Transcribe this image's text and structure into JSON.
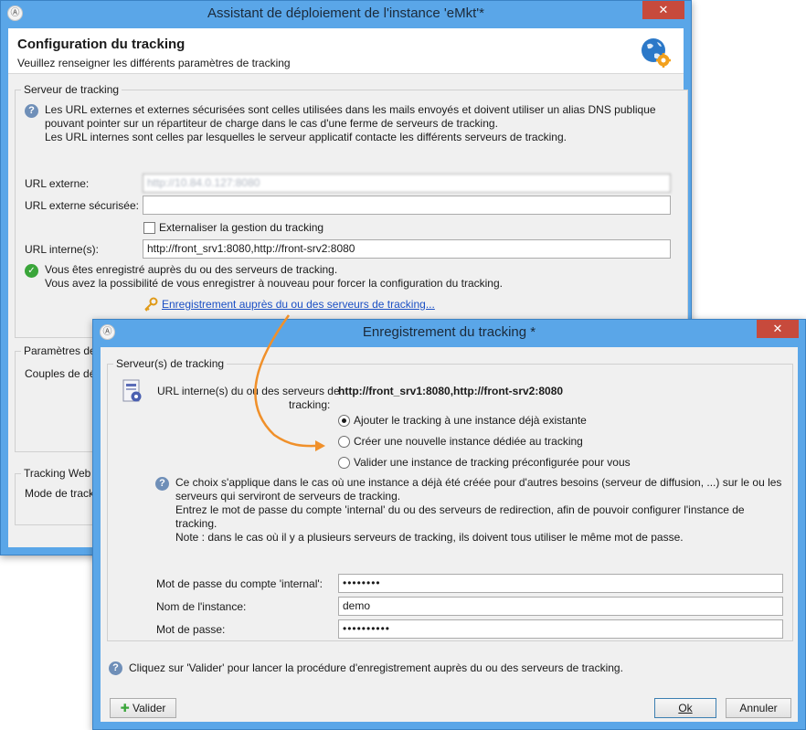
{
  "back_window": {
    "title": "Assistant de déploiement de l'instance 'eMkt'*",
    "heading": "Configuration du tracking",
    "subheading": "Veuillez renseigner les différents paramètres de tracking",
    "server_group": {
      "legend": "Serveur de tracking",
      "help_line1": "Les URL externes et externes sécurisées sont celles utilisées dans les mails envoyés et doivent utiliser un alias DNS publique",
      "help_line2": "pouvant pointer sur un répartiteur de charge dans le cas d'une ferme de serveurs de tracking.",
      "help_line3": "Les URL internes sont celles par lesquelles le serveur applicatif contacte les différents serveurs de tracking.",
      "external_url_label": "URL externe:",
      "external_url_value": "http://10.84.0.127:8080",
      "secure_url_label": "URL externe sécurisée:",
      "secure_url_value": "",
      "externalize_label": "Externaliser la gestion du tracking",
      "internal_url_label": "URL interne(s):",
      "internal_url_value": "http://front_srv1:8080,http://front-srv2:8080",
      "status_line1": "Vous êtes enregistré auprès du ou des serveurs de tracking.",
      "status_line2": "Vous avez la possibilité de vous enregistrer à nouveau pour forcer la configuration du tracking.",
      "register_link": "Enregistrement auprès du ou des serveurs de tracking..."
    },
    "params_group": {
      "legend": "Paramètres de",
      "couples_label": "Couples de dé"
    },
    "web_group": {
      "legend": "Tracking Web",
      "mode_label": "Mode de track"
    }
  },
  "front_window": {
    "title": "Enregistrement du tracking *",
    "group_legend": "Serveur(s) de tracking",
    "internal_url_label_line1": "URL interne(s) du ou des serveurs de",
    "internal_url_label_line2": "tracking:",
    "internal_url_value": "http://front_srv1:8080,http://front-srv2:8080",
    "options": [
      {
        "label": "Ajouter le tracking à une instance déjà existante",
        "checked": true
      },
      {
        "label": "Créer une nouvelle instance dédiée au tracking",
        "checked": false
      },
      {
        "label": "Valider une instance de tracking préconfigurée pour vous",
        "checked": false
      }
    ],
    "info_line1": "Ce choix s'applique dans le cas où une instance a déjà été créée pour d'autres besoins (serveur de diffusion, ...) sur le ou les",
    "info_line2": "serveurs qui serviront de serveurs de tracking.",
    "info_line3": "Entrez le mot de passe du compte 'internal' du ou des serveurs de redirection, afin de pouvoir configurer l'instance de",
    "info_line4": "tracking.",
    "info_line5": "Note : dans le cas où il y a plusieurs serveurs de tracking, ils doivent tous utiliser le même mot de passe.",
    "internal_password_label": "Mot de passe du compte 'internal':",
    "internal_password_value": "••••••••",
    "instance_name_label": "Nom de l'instance:",
    "instance_name_value": "demo",
    "password_label": "Mot de passe:",
    "password_value": "••••••••••",
    "footer_help": "Cliquez sur 'Valider' pour lancer la procédure d'enregistrement auprès du ou des serveurs de tracking.",
    "validate_button": "Valider",
    "ok_button": "Ok",
    "cancel_button": "Annuler"
  },
  "colors": {
    "title_bar": "#5aa6e8",
    "close_button": "#c74a3c",
    "link": "#1a4fc4",
    "arrow": "#f0902a"
  }
}
